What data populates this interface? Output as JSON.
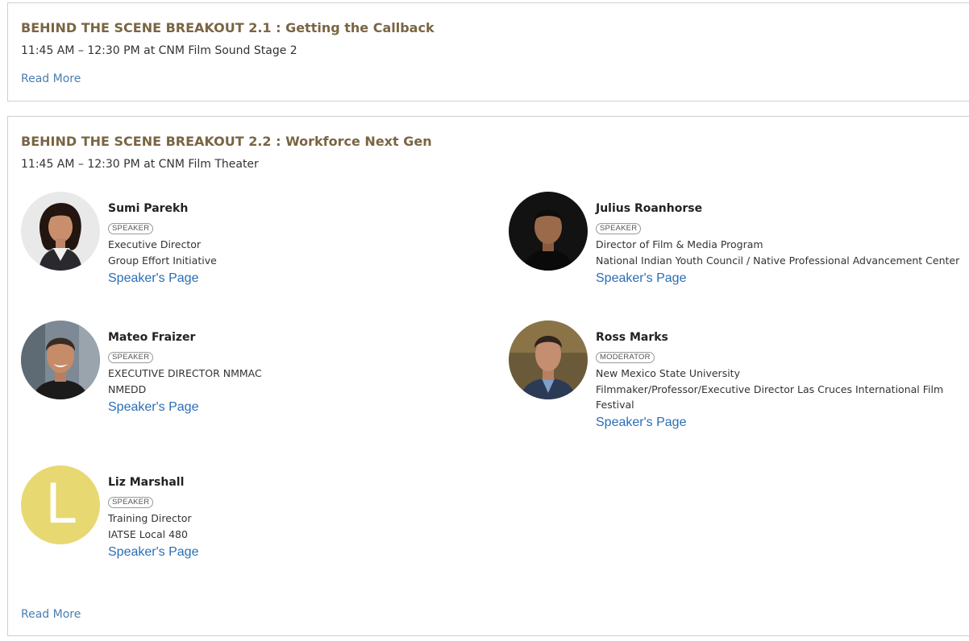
{
  "sessions": [
    {
      "title": "BEHIND THE SCENE BREAKOUT 2.1 : Getting the Callback",
      "time": "11:45 AM – 12:30 PM",
      "location": "at CNM Film Sound Stage 2",
      "read_more": "Read More"
    },
    {
      "title": "BEHIND THE SCENE BREAKOUT 2.2 : Workforce Next Gen",
      "time": "11:45 AM – 12:30 PM",
      "location": "at CNM Film Theater",
      "read_more": "Read More",
      "speakers": [
        {
          "name": "Sumi Parekh",
          "badge": "SPEAKER",
          "lines": [
            "Executive Director",
            "Group Effort Initiative"
          ],
          "link": "Speaker's Page"
        },
        {
          "name": "Julius Roanhorse",
          "badge": "SPEAKER",
          "lines": [
            "Director of Film & Media Program",
            "National Indian Youth Council / Native Professional Advancement Center"
          ],
          "link": "Speaker's Page"
        },
        {
          "name": "Mateo Fraizer",
          "badge": "SPEAKER",
          "lines": [
            "EXECUTIVE DIRECTOR NMMAC",
            "NMEDD"
          ],
          "link": "Speaker's Page"
        },
        {
          "name": "Ross Marks",
          "badge": "MODERATOR",
          "lines": [
            "New Mexico State University",
            "Filmmaker/Professor/Executive Director Las Cruces International Film",
            "Festival"
          ],
          "link": "Speaker's Page"
        },
        {
          "name": "Liz Marshall",
          "badge": "SPEAKER",
          "lines": [
            "Training Director",
            "IATSE Local 480"
          ],
          "link": "Speaker's Page",
          "avatar_letter": "L",
          "avatar_color": "#e8d871"
        }
      ]
    }
  ],
  "colors": {
    "title": "#7a6543",
    "link": "#2a6db5",
    "read_more": "#4a7fb0",
    "border": "#cfcfcf"
  }
}
